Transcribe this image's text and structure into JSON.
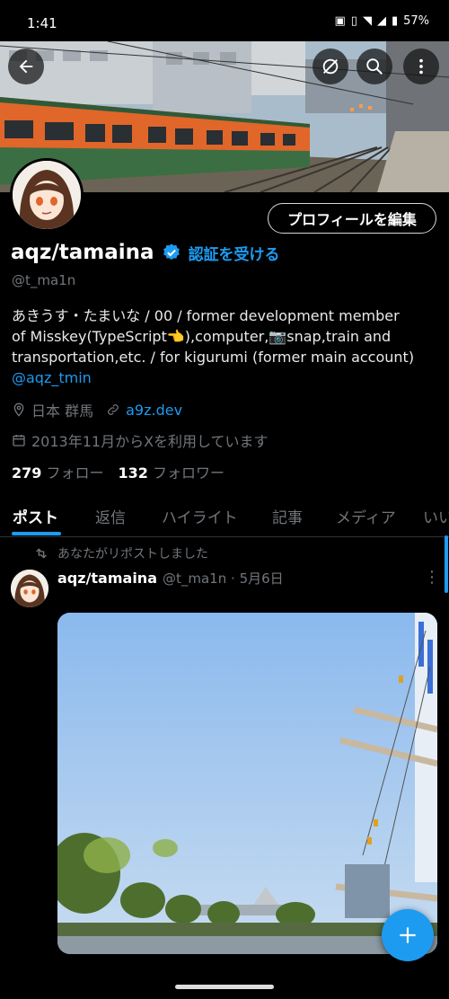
{
  "status_bar": {
    "time": "1:41",
    "battery": "57%"
  },
  "header": {
    "back_icon": "arrow-left-icon",
    "grok_icon": "grok-icon",
    "search_icon": "search-icon",
    "more_icon": "more-vertical-icon"
  },
  "profile": {
    "display_name": "aqz/tamaina",
    "verify_cta": "認証を受ける",
    "handle": "@t_ma1n",
    "edit_button": "プロフィールを編集",
    "bio_lines": [
      "あきうす・たまいな / 00 / former development member",
      "of Misskey(TypeScript👈),computer,📷snap,train and",
      "transportation,etc. / for kigurumi (former main account)"
    ],
    "bio_mention": "@aqz_tmin",
    "location": "日本 群馬",
    "website": "a9z.dev",
    "joined": "2013年11月からXを利用しています",
    "following_count": "279",
    "following_label": "フォロー",
    "followers_count": "132",
    "followers_label": "フォロワー"
  },
  "tabs": [
    {
      "label": "ポスト",
      "active": true
    },
    {
      "label": "返信",
      "active": false
    },
    {
      "label": "ハイライト",
      "active": false
    },
    {
      "label": "記事",
      "active": false
    },
    {
      "label": "メディア",
      "active": false
    },
    {
      "label": "いい",
      "active": false
    }
  ],
  "post": {
    "repost_note": "あなたがリポストしました",
    "author_name": "aqz/tamaina",
    "author_handle": "@t_ma1n",
    "date": "5月6日"
  },
  "fab_icon": "plus-icon",
  "colors": {
    "accent": "#1d9bf0",
    "background": "#000000",
    "muted": "#71767b",
    "train_orange": "#e0662a",
    "train_green": "#3c6e43"
  }
}
